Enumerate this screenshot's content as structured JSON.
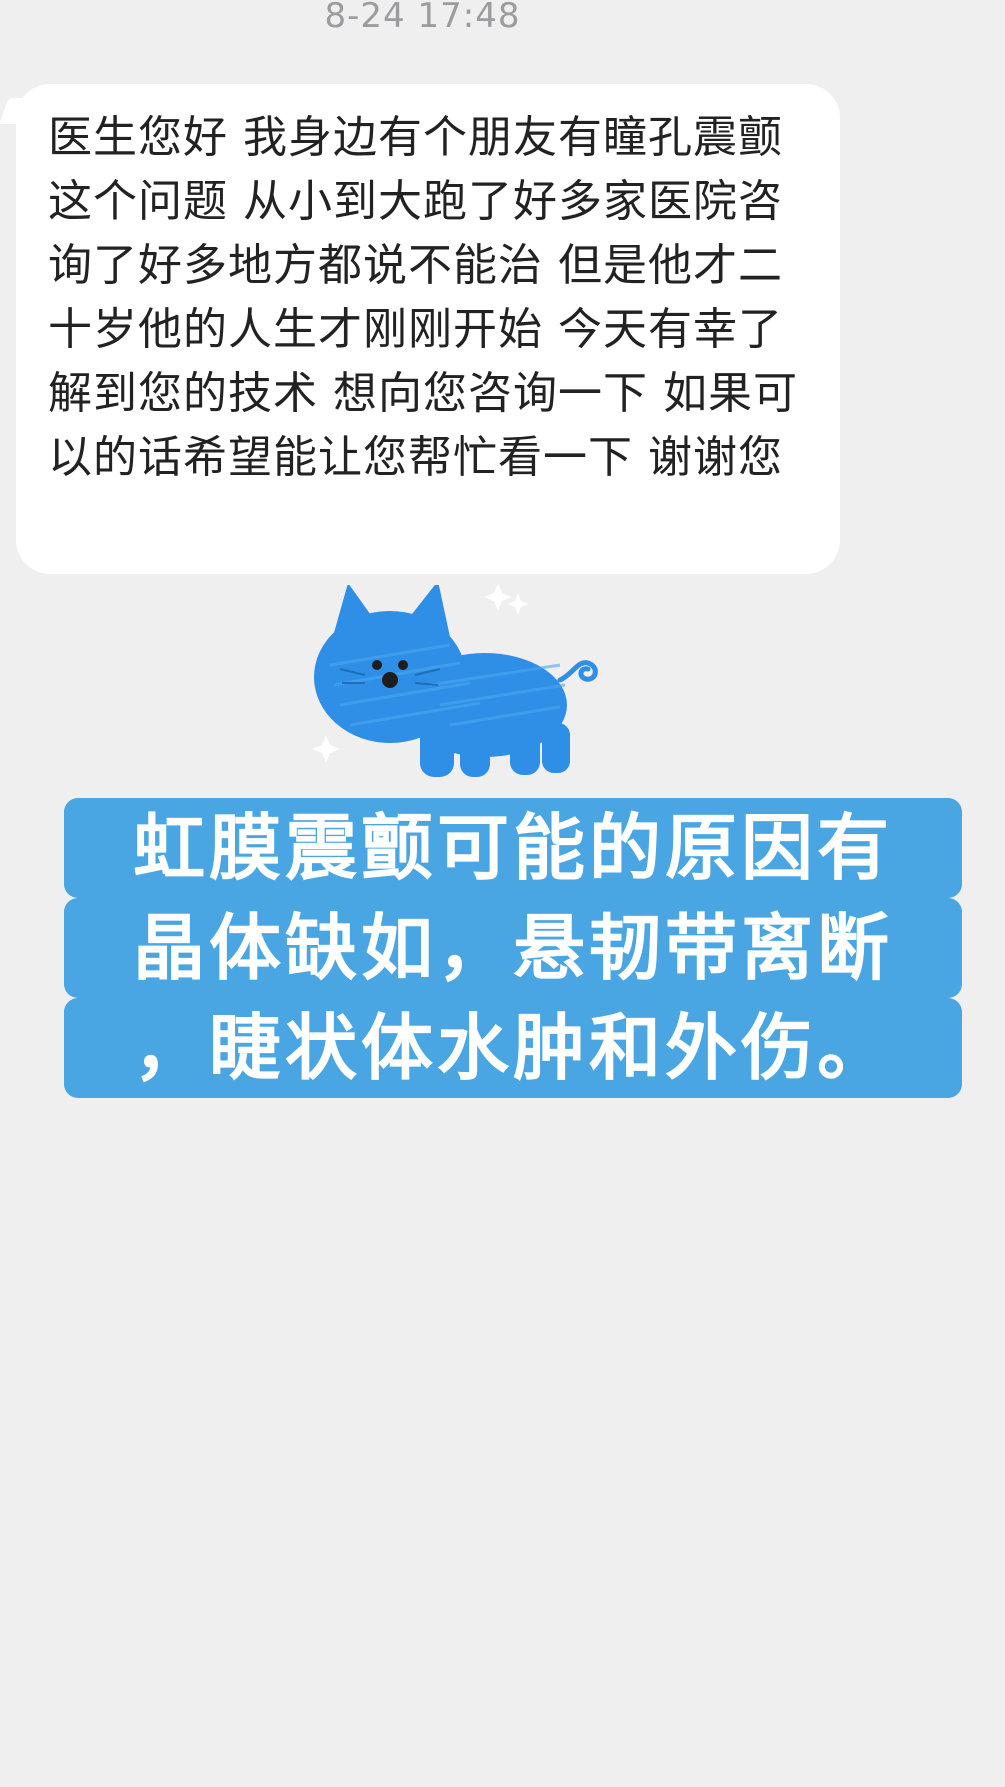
{
  "chat": {
    "timestamp": "8-24 17:48",
    "message": "医生您好 我身边有个朋友有瞳孔震颤这个问题 从小到大跑了好多家医院咨询了好多地方都说不能治 但是他才二十岁他的人生才刚刚开始 今天有幸了解到您的技术 想向您咨询一下 如果可以的话希望能让您帮忙看一下 谢谢您"
  },
  "sticker": {
    "icon": "blue-cat-sticker",
    "color": "#2f8ee6"
  },
  "caption": {
    "lines": [
      "虹膜震颤可能的原因有",
      "晶体缺如，悬韧带离断",
      "，睫状体水肿和外伤。"
    ],
    "background": "#4aa6e2",
    "text_color": "#ffffff"
  }
}
